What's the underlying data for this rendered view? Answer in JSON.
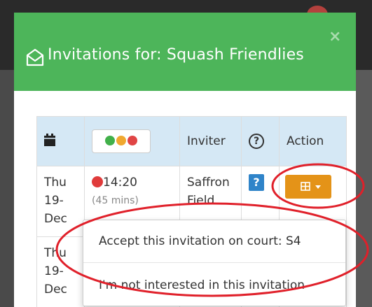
{
  "modal": {
    "title": "Invitations for: Squash Friendlies",
    "close_glyph": "×",
    "header_color": "#4db55a"
  },
  "table": {
    "headers": {
      "date_icon": "calendar-icon",
      "status_colors": [
        "#41b04a",
        "#f0a830",
        "#e04545"
      ],
      "inviter": "Inviter",
      "help": "?",
      "action": "Action"
    },
    "rows": [
      {
        "day": "Thu",
        "date": "19-",
        "month": "Dec",
        "time": "14:20",
        "duration": "(45 mins)",
        "inviter_first": "Saffron",
        "inviter_last": "Field",
        "help": "?"
      },
      {
        "day": "Thu",
        "date": "19-",
        "month": "Dec"
      }
    ]
  },
  "dropdown": {
    "items": [
      "Accept this invitation on court: S4",
      "I'm not interested in this invitation"
    ]
  },
  "colors": {
    "action_button": "#e49318",
    "help_button": "#2f84c9",
    "annotation": "#e0202a"
  }
}
